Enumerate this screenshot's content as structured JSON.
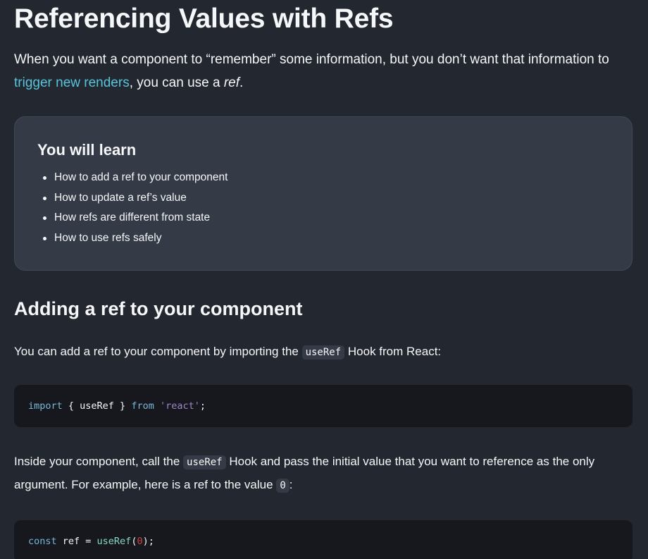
{
  "article": {
    "title": "Referencing Values with Refs",
    "intro": {
      "before_link": "When you want a component to “remember” some information, but you don’t want that information to ",
      "link_text": "trigger new renders",
      "after_link": ", you can use a ",
      "emphasis": "ref",
      "end": "."
    }
  },
  "learn_box": {
    "title": "You will learn",
    "items": [
      "How to add a ref to your component",
      "How to update a ref’s value",
      "How refs are different from state",
      "How to use refs safely"
    ]
  },
  "section": {
    "heading": "Adding a ref to your component",
    "para1": {
      "before_code": "You can add a ref to your component by importing the ",
      "code": "useRef",
      "after_code": " Hook from React:"
    },
    "code1": {
      "import_kw": "import",
      "brace_open": " { useRef } ",
      "from_kw": "from",
      "space": " ",
      "module": "'react'",
      "semi": ";"
    },
    "para2": {
      "before_code": "Inside your component, call the ",
      "code": "useRef",
      "middle": " Hook and pass the initial value that you want to reference as the only argument. For example, here is a ref to the value ",
      "value_code": "0",
      "end": ":"
    },
    "code2": {
      "const_kw": "const",
      "assign": " ref = ",
      "fn": "useRef",
      "paren_open": "(",
      "num": "0",
      "paren_close": ");"
    }
  },
  "colors": {
    "background": "#23272f",
    "link": "#58c4dc",
    "card": "#343a46",
    "code_bg": "#16181d"
  }
}
